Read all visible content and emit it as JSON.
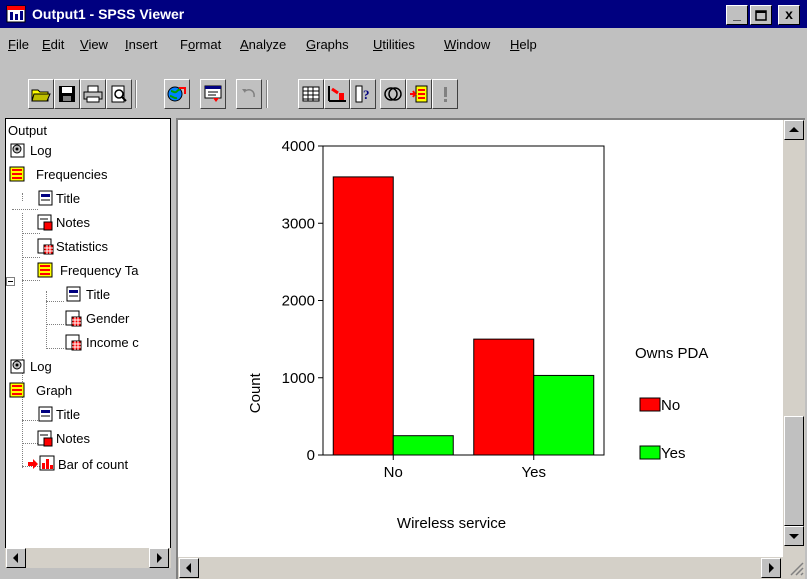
{
  "window": {
    "title": "Output1 - SPSS Viewer",
    "min_label": "_",
    "max_label": "□",
    "close_label": "x"
  },
  "menu": [
    {
      "label": "File",
      "key": "F",
      "rest": "ile"
    },
    {
      "label": "Edit",
      "key": "E",
      "rest": "dit"
    },
    {
      "label": "View",
      "key": "V",
      "rest": "iew"
    },
    {
      "label": "Insert",
      "key": "I",
      "rest": "nsert"
    },
    {
      "label": "Format",
      "key": "o",
      "pre": "F",
      "rest": "rmat"
    },
    {
      "label": "Analyze",
      "key": "A",
      "rest": "nalyze"
    },
    {
      "label": "Graphs",
      "key": "G",
      "rest": "raphs"
    },
    {
      "label": "Utilities",
      "key": "U",
      "rest": "tilities"
    },
    {
      "label": "Window",
      "key": "W",
      "rest": "indow"
    },
    {
      "label": "Help",
      "key": "H",
      "rest": "elp"
    }
  ],
  "toolbar": {
    "buttons": [
      "open-icon",
      "save-icon",
      "print-icon",
      "print-preview-icon",
      "export-icon",
      "dialog-recall-icon",
      "undo-icon",
      "goto-data-icon",
      "goto-chart-icon",
      "variables-icon",
      "use-sets-icon",
      "designate-window-icon",
      "show-all-icon"
    ]
  },
  "outline": {
    "root": "Output",
    "items": [
      {
        "label": "Log",
        "icon": "log-icon"
      },
      {
        "label": "Frequencies",
        "icon": "procedure-icon"
      },
      {
        "label": "Title",
        "icon": "title-icon"
      },
      {
        "label": "Notes",
        "icon": "notes-icon"
      },
      {
        "label": "Statistics",
        "icon": "table-icon"
      },
      {
        "label": "Frequency Ta",
        "icon": "procedure-icon"
      },
      {
        "label": "Title",
        "icon": "title-icon"
      },
      {
        "label": "Gender",
        "icon": "table-icon"
      },
      {
        "label": "Income c",
        "icon": "table-icon"
      },
      {
        "label": "Log",
        "icon": "log-icon"
      },
      {
        "label": "Graph",
        "icon": "procedure-icon"
      },
      {
        "label": "Title",
        "icon": "title-icon"
      },
      {
        "label": "Notes",
        "icon": "notes-icon"
      },
      {
        "label": "Bar of count",
        "icon": "chart-icon"
      }
    ]
  },
  "colors": {
    "no": "#ff0000",
    "yes": "#00ff00",
    "titlebar": "#000080"
  },
  "chart_data": {
    "type": "bar",
    "categories": [
      "No",
      "Yes"
    ],
    "series": [
      {
        "name": "No",
        "values": [
          3600,
          1500
        ]
      },
      {
        "name": "Yes",
        "values": [
          250,
          1030
        ]
      }
    ],
    "ylim": [
      0,
      4000
    ],
    "yticks": [
      "0",
      "1000",
      "2000",
      "3000",
      "4000"
    ],
    "xlabel": "Wireless service",
    "ylabel": "Count",
    "legend_title": "Owns PDA",
    "legend_position": "right",
    "grid": false
  }
}
